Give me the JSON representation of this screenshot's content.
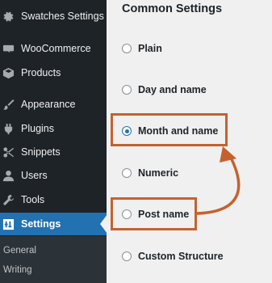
{
  "sidebar": {
    "items": [
      {
        "label": "Swatches Settings",
        "icon": "gear-icon"
      },
      {
        "label": "WooCommerce",
        "icon": "woocommerce-icon"
      },
      {
        "label": "Products",
        "icon": "box-icon"
      },
      {
        "label": "Appearance",
        "icon": "paintbrush-icon"
      },
      {
        "label": "Plugins",
        "icon": "plug-icon"
      },
      {
        "label": "Snippets",
        "icon": "scissors-icon"
      },
      {
        "label": "Users",
        "icon": "user-icon"
      },
      {
        "label": "Tools",
        "icon": "wrench-icon"
      },
      {
        "label": "Settings",
        "icon": "sliders-icon",
        "active": true
      }
    ],
    "submenu": [
      {
        "label": "General"
      },
      {
        "label": "Writing"
      }
    ]
  },
  "main": {
    "title": "Common Settings",
    "options": [
      {
        "label": "Plain",
        "checked": false
      },
      {
        "label": "Day and name",
        "checked": false
      },
      {
        "label": "Month and name",
        "checked": true,
        "highlighted": true
      },
      {
        "label": "Numeric",
        "checked": false
      },
      {
        "label": "Post name",
        "checked": false,
        "highlighted": true
      },
      {
        "label": "Custom Structure",
        "checked": false
      }
    ]
  },
  "annotation": {
    "color": "#c4622d",
    "from": "Post name",
    "to": "Month and name"
  },
  "colors": {
    "sidebar_bg": "#1d2327",
    "active_bg": "#2271b1",
    "main_bg": "#f0f0f1"
  }
}
